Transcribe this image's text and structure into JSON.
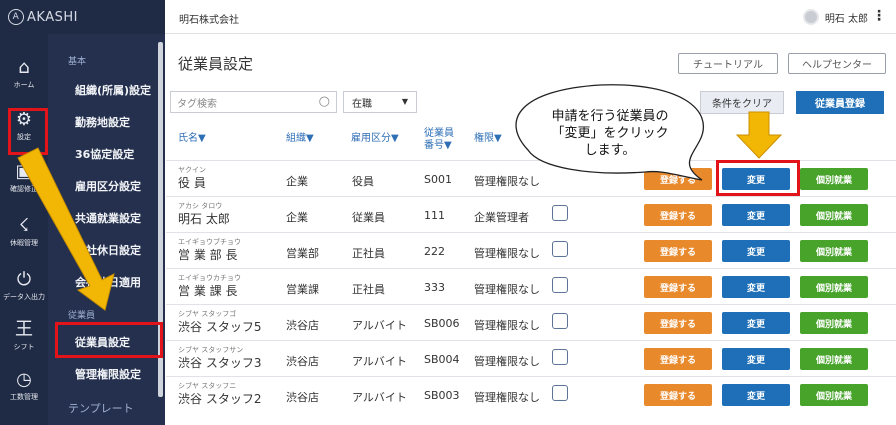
{
  "app": {
    "brand": "AKASHI",
    "brand_mark": "A",
    "company": "明石株式会社",
    "user_name": "明石 太郎",
    "menu_icon": "⋮"
  },
  "rail": [
    {
      "icon": "⌂",
      "label": "ホーム"
    },
    {
      "icon": "⚙",
      "label": "設定"
    },
    {
      "icon": "▣",
      "label": "確認修正"
    },
    {
      "icon": "☇",
      "label": "休暇管理"
    },
    {
      "icon": "⏻",
      "label": "データ入出力"
    },
    {
      "icon": "王",
      "label": "シフト"
    },
    {
      "icon": "◷",
      "label": "工数管理"
    }
  ],
  "submenu": {
    "group_basic": "基本",
    "items_basic": [
      "組織(所属)設定",
      "勤務地設定",
      "36協定設定",
      "雇用区分設定",
      "共通就業設定",
      "会社休日設定",
      "会社休日適用"
    ],
    "group_employee": "従業員",
    "items_employee": [
      "従業員設定",
      "管理権限設定"
    ],
    "group_template": "テンプレート"
  },
  "main": {
    "title": "従業員設定",
    "tutorial": "チュートリアル",
    "help": "ヘルプセンター",
    "tag_placeholder": "タグ検索",
    "search_icon": "○",
    "status": "在職",
    "status_caret": "▼",
    "clear": "条件をクリア",
    "register": "従業員登録"
  },
  "columns": {
    "name": "氏名▼",
    "org": "組織▼",
    "type": "雇用区分▼",
    "number_l1": "従業員",
    "number_l2": "番号▼",
    "perm": "権限▼"
  },
  "rows": [
    {
      "kana": "ヤクイン",
      "name": "役 員",
      "org": "企業",
      "type": "役員",
      "no": "S001",
      "perm": "管理権限なし"
    },
    {
      "kana": "アカシ タロウ",
      "name": "明石 太郎",
      "org": "企業",
      "type": "従業員",
      "no": "111",
      "perm": "企業管理者"
    },
    {
      "kana": "エイギョウブチョウ",
      "name": "営 業 部 長",
      "org": "営業部",
      "type": "正社員",
      "no": "222",
      "perm": "管理権限なし"
    },
    {
      "kana": "エイギョウカチョウ",
      "name": "営 業 課 長",
      "org": "営業課",
      "type": "正社員",
      "no": "333",
      "perm": "管理権限なし"
    },
    {
      "kana": "シブヤ スタッフゴ",
      "name": "渋谷 スタッフ5",
      "org": "渋谷店",
      "type": "アルバイト",
      "no": "SB006",
      "perm": "管理権限なし"
    },
    {
      "kana": "シブヤ スタッフサン",
      "name": "渋谷 スタッフ3",
      "org": "渋谷店",
      "type": "アルバイト",
      "no": "SB004",
      "perm": "管理権限なし"
    },
    {
      "kana": "シブヤ スタッフニ",
      "name": "渋谷 スタッフ2",
      "org": "渋谷店",
      "type": "アルバイト",
      "no": "SB003",
      "perm": "管理権限なし"
    }
  ],
  "row_buttons": {
    "register": "登録する",
    "change": "変更",
    "individual": "個別就業"
  },
  "annotation": {
    "bubble_l1": "申請を行う従業員の",
    "bubble_l2": "「変更」をクリック",
    "bubble_l3": "します。"
  },
  "colors": {
    "navy": "#1f2a44",
    "blue": "#1e6fb7",
    "orange": "#e8892b",
    "green": "#48a32b",
    "red": "#e2141a",
    "arrow": "#f2b705"
  }
}
